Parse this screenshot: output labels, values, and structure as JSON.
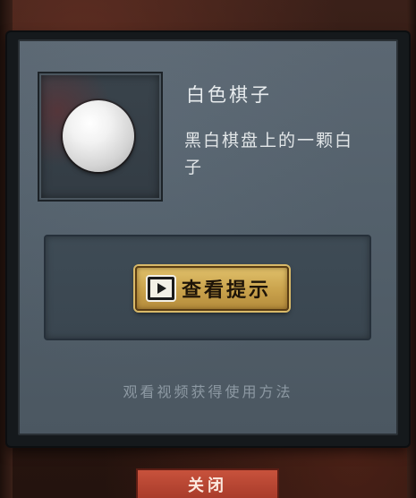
{
  "item": {
    "name": "白色棋子",
    "description": "黑白棋盘上的一颗白子",
    "icon": "white-go-stone"
  },
  "hint_button": {
    "icon": "play-video-icon",
    "label": "查看提示"
  },
  "footnote": "观看视频获得使用方法",
  "close_button": {
    "label": "关闭"
  },
  "colors": {
    "panel": "#55616c",
    "hint_button": "#c9a24c",
    "close_button": "#b4432f",
    "text": "#e8ecee"
  }
}
